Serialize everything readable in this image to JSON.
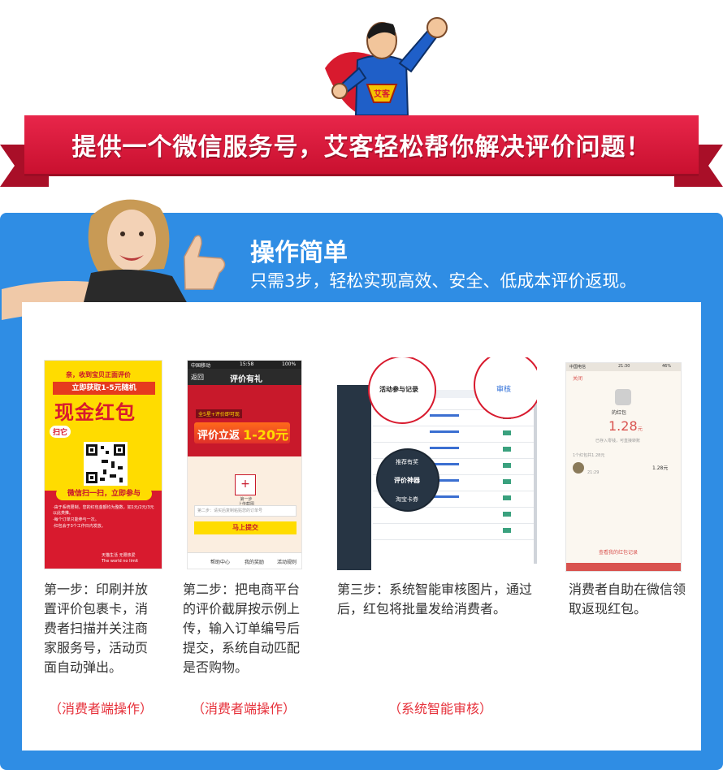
{
  "hero": {
    "badge_text": "艾客",
    "banner": "提供一个微信服务号，艾客轻松帮你解决评价问题！"
  },
  "intro": {
    "title": "操作简单",
    "subtitle": "只需3步，轻松实现高效、安全、低成本评价返现。"
  },
  "card1": {
    "line1": "亲，收到宝贝正面评价",
    "line2": "立即获取1-5元随机",
    "big": "现金红包",
    "scan": "扫它",
    "scan_cta": "微信扫一扫，立即参与",
    "rule1": "·由于系统限制，您的红包金额均为整数，如1元/2元/3元以此类推。",
    "rule2": "·每个订单只能参与一次。",
    "rule3": "·红包会于3个工作日内发放。",
    "brand": "天猫生活 无限热爱",
    "brand_en": "The world no limit"
  },
  "card2": {
    "status_left": "中国移动",
    "status_time": "15:58",
    "status_right": "100%",
    "back": "返回",
    "nav_title": "评价有礼",
    "promo_tag": "全5星+评价即可现",
    "promo_main": "评价立返",
    "promo_amount": "1-20元",
    "upload_label": "第一步\n上传截图",
    "order_placeholder": "第二步：请买后复制粘贴您的订单号",
    "submit": "马上提交",
    "tabs": [
      "帮助中心",
      "我的奖励",
      "活动规则"
    ]
  },
  "card3": {
    "callout_top": "活动参与记录",
    "callout_right": "审核",
    "menu": [
      "推荐有奖",
      "评价神器",
      "淘宝卡券"
    ]
  },
  "card4": {
    "status_left": "中国电信",
    "status_time": "21:30",
    "status_right": "46%",
    "close": "关闭",
    "redpack_title": "的红包",
    "amount": "1.28",
    "amount_unit": "元",
    "amount_note": "已存入零钱，可直接转账",
    "record_header": "1个红包共1.28元",
    "record_time": "21:29",
    "record_amount": "1.28元",
    "history_link": "查看我的红包记录"
  },
  "steps": [
    {
      "text": "第一步：印刷并放置评价包裹卡，消费者扫描并关注商家服务号，活动页面自动弹出。"
    },
    {
      "text": "第二步：把电商平台的评价截屏按示例上传，输入订单编号后提交，系统自动匹配是否购物。"
    },
    {
      "text": "第三步：系统智能审核图片，通过后，红包将批量发给消费者。"
    },
    {
      "text": "消费者自助在微信领取返现红包。"
    }
  ],
  "labels": {
    "consumer_1": "（消费者端操作）",
    "consumer_2": "（消费者端操作）",
    "system": "（系统智能审核）"
  },
  "colors": {
    "banner_red": "#d81a3a",
    "panel_blue": "#2f8de4",
    "label_red": "#e6303a",
    "card_yellow": "#ffdc00",
    "card_red": "#c8192b"
  }
}
